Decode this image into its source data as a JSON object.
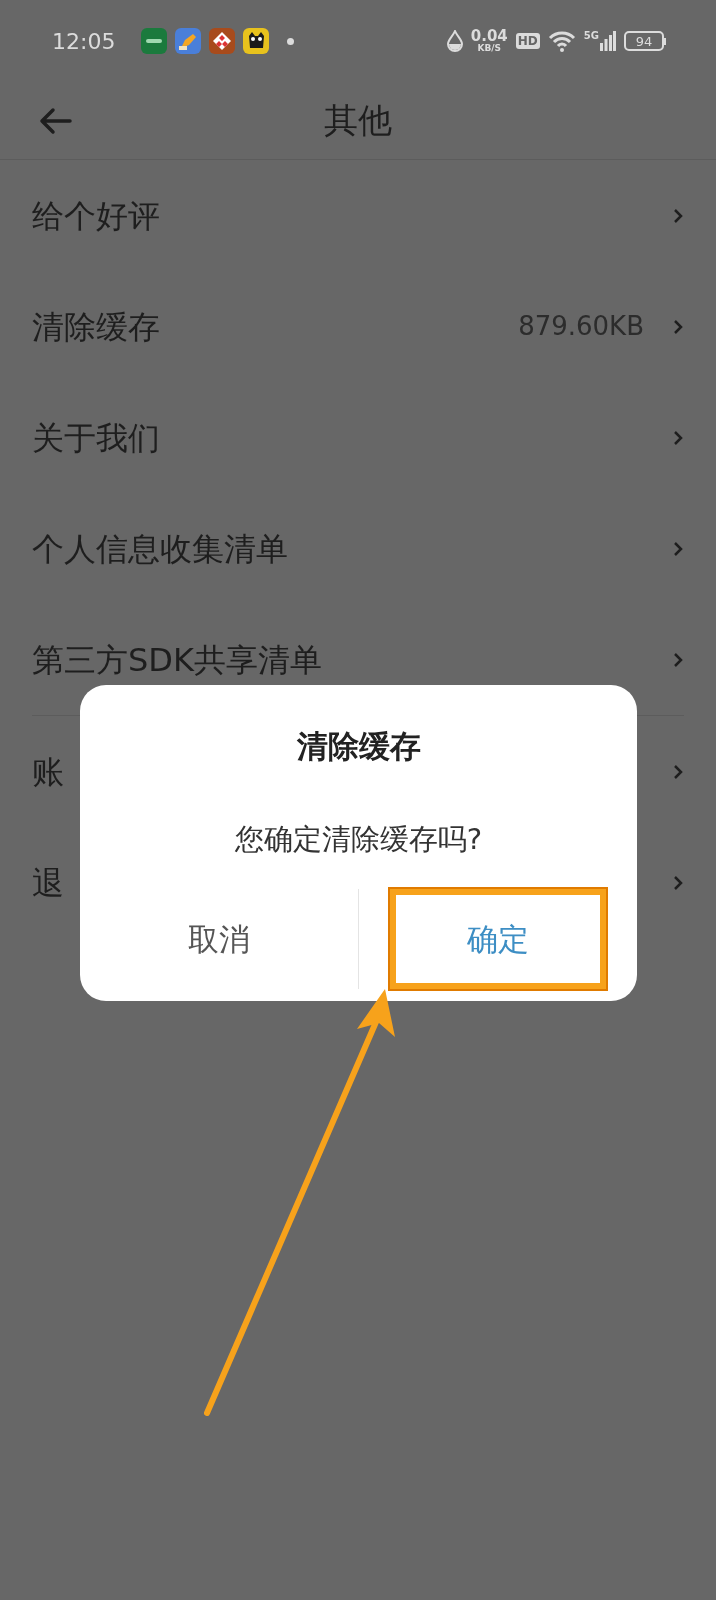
{
  "status_bar": {
    "time": "12:05",
    "apps": [
      {
        "kind": "oppo"
      },
      {
        "kind": "pencil"
      },
      {
        "kind": "checker"
      },
      {
        "kind": "cat"
      }
    ],
    "notification_dot": true,
    "net_speed": "0.04",
    "net_unit": "KB/S",
    "hd": "HD",
    "network": "5G",
    "battery": "94"
  },
  "header": {
    "title": "其他"
  },
  "groups": [
    [
      {
        "label": "给个好评"
      },
      {
        "label": "清除缓存",
        "value": "879.60KB"
      },
      {
        "label": "关于我们"
      },
      {
        "label": "个人信息收集清单"
      },
      {
        "label": "第三方SDK共享清单"
      }
    ],
    [
      {
        "label": "账"
      },
      {
        "label": "退"
      }
    ]
  ],
  "dialog": {
    "title": "清除缓存",
    "message": "您确定清除缓存吗?",
    "buttons": [
      {
        "label": "取消",
        "kind": "cancel",
        "annotated": false
      },
      {
        "label": "确定",
        "kind": "confirm",
        "annotated": true
      }
    ]
  }
}
